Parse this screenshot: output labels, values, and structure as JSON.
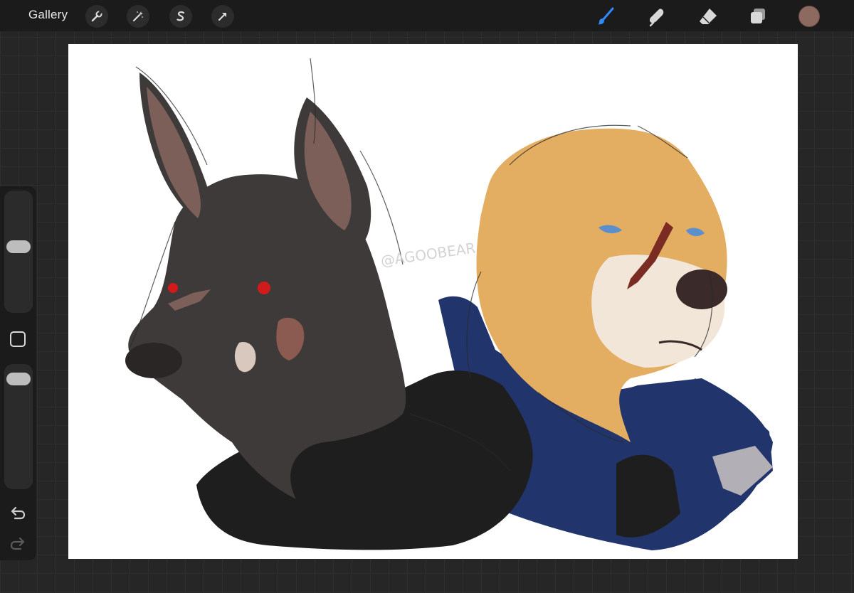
{
  "topbar": {
    "gallery_label": "Gallery",
    "left_tools": [
      {
        "name": "actions",
        "icon": "wrench-icon"
      },
      {
        "name": "adjustments",
        "icon": "magic-wand-icon"
      },
      {
        "name": "selection",
        "icon": "selection-s-icon"
      },
      {
        "name": "transform",
        "icon": "arrow-cursor-icon"
      }
    ],
    "right_tools": [
      {
        "name": "brush",
        "icon": "brush-icon",
        "active": true,
        "color": "#2f8cff"
      },
      {
        "name": "smudge",
        "icon": "smudge-finger-icon",
        "active": false
      },
      {
        "name": "eraser",
        "icon": "eraser-icon",
        "active": false
      },
      {
        "name": "layers",
        "icon": "layers-icon",
        "active": false
      }
    ],
    "current_color": "#8d6a60"
  },
  "sidebar": {
    "brush_size_level": 0.45,
    "opacity_level": 0.05,
    "modify_icon": "square-icon",
    "undo_icon": "undo-arrow-icon",
    "redo_icon": "redo-arrow-icon"
  },
  "canvas": {
    "background": "#ffffff",
    "watermark": "@AGOOBEAR",
    "palette": {
      "dog_left_fur": "#3e3a39",
      "dog_left_ear_inner": "#7d5f5a",
      "dog_left_eye": "#d11a1a",
      "dog_left_wound": "#8b5a50",
      "dog_right_fur": "#e3ad62",
      "dog_right_muzzle": "#f2e6d8",
      "dog_right_eye": "#5c8fcb",
      "dog_right_nose": "#3a2a2a",
      "dog_right_scar": "#7a2b22",
      "hoodie_black": "#1e1e1e",
      "jacket_blue": "#21346b",
      "jacket_patch": "#b2b0b6"
    }
  }
}
